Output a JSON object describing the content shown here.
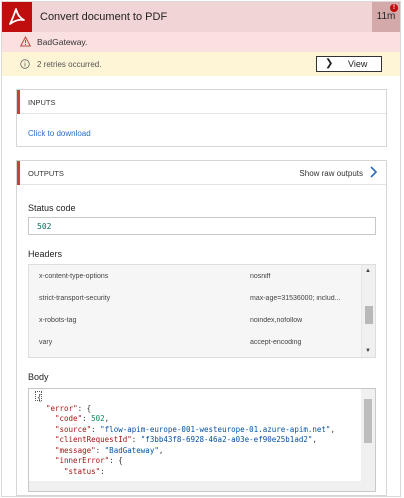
{
  "header": {
    "title": "Convert document to PDF",
    "duration": "11m",
    "notification_count": "!",
    "brand_color": "#c00d0d",
    "icon": "acrobat-icon"
  },
  "error_banner": {
    "icon": "warning-triangle-icon",
    "text": "BadGateway."
  },
  "retry_banner": {
    "icon": "info-circle-icon",
    "text": "2 retries occurred.",
    "view_label": "View"
  },
  "inputs": {
    "title": "INPUTS",
    "link": "Click to download"
  },
  "outputs": {
    "title": "OUTPUTS",
    "raw_label": "Show raw outputs",
    "status_label": "Status code",
    "status_value": "502",
    "headers_label": "Headers",
    "headers": [
      {
        "key": "x-content-type-options",
        "value": "nosniff"
      },
      {
        "key": "strict-transport-security",
        "value": "max-age=31536000; includ..."
      },
      {
        "key": "x-robots-tag",
        "value": "noindex,nofollow"
      },
      {
        "key": "vary",
        "value": "accept-encoding"
      }
    ],
    "headers_scroll_position": 0.55,
    "body_label": "Body",
    "body_lines": [
      {
        "indent": 0,
        "punct": "{"
      },
      {
        "indent": 1,
        "key": "\"error\"",
        "punct": ": {"
      },
      {
        "indent": 2,
        "key": "\"code\"",
        "sep": ": ",
        "num": "502",
        "end": ","
      },
      {
        "indent": 2,
        "key": "\"source\"",
        "sep": ": ",
        "str": "\"flow-apim-europe-001-westeurope-01.azure-apim.net\"",
        "end": ","
      },
      {
        "indent": 2,
        "key": "\"clientRequestId\"",
        "sep": ": ",
        "str": "\"f3bb43f8-6928-46a2-a03e-ef90e25b1ad2\"",
        "end": ","
      },
      {
        "indent": 2,
        "key": "\"message\"",
        "sep": ": ",
        "str": "\"BadGateway\"",
        "end": ","
      },
      {
        "indent": 2,
        "key": "\"innerError\"",
        "punct": ": {"
      },
      {
        "indent": 3,
        "key": "\"status\"",
        "punct": ": "
      }
    ]
  }
}
